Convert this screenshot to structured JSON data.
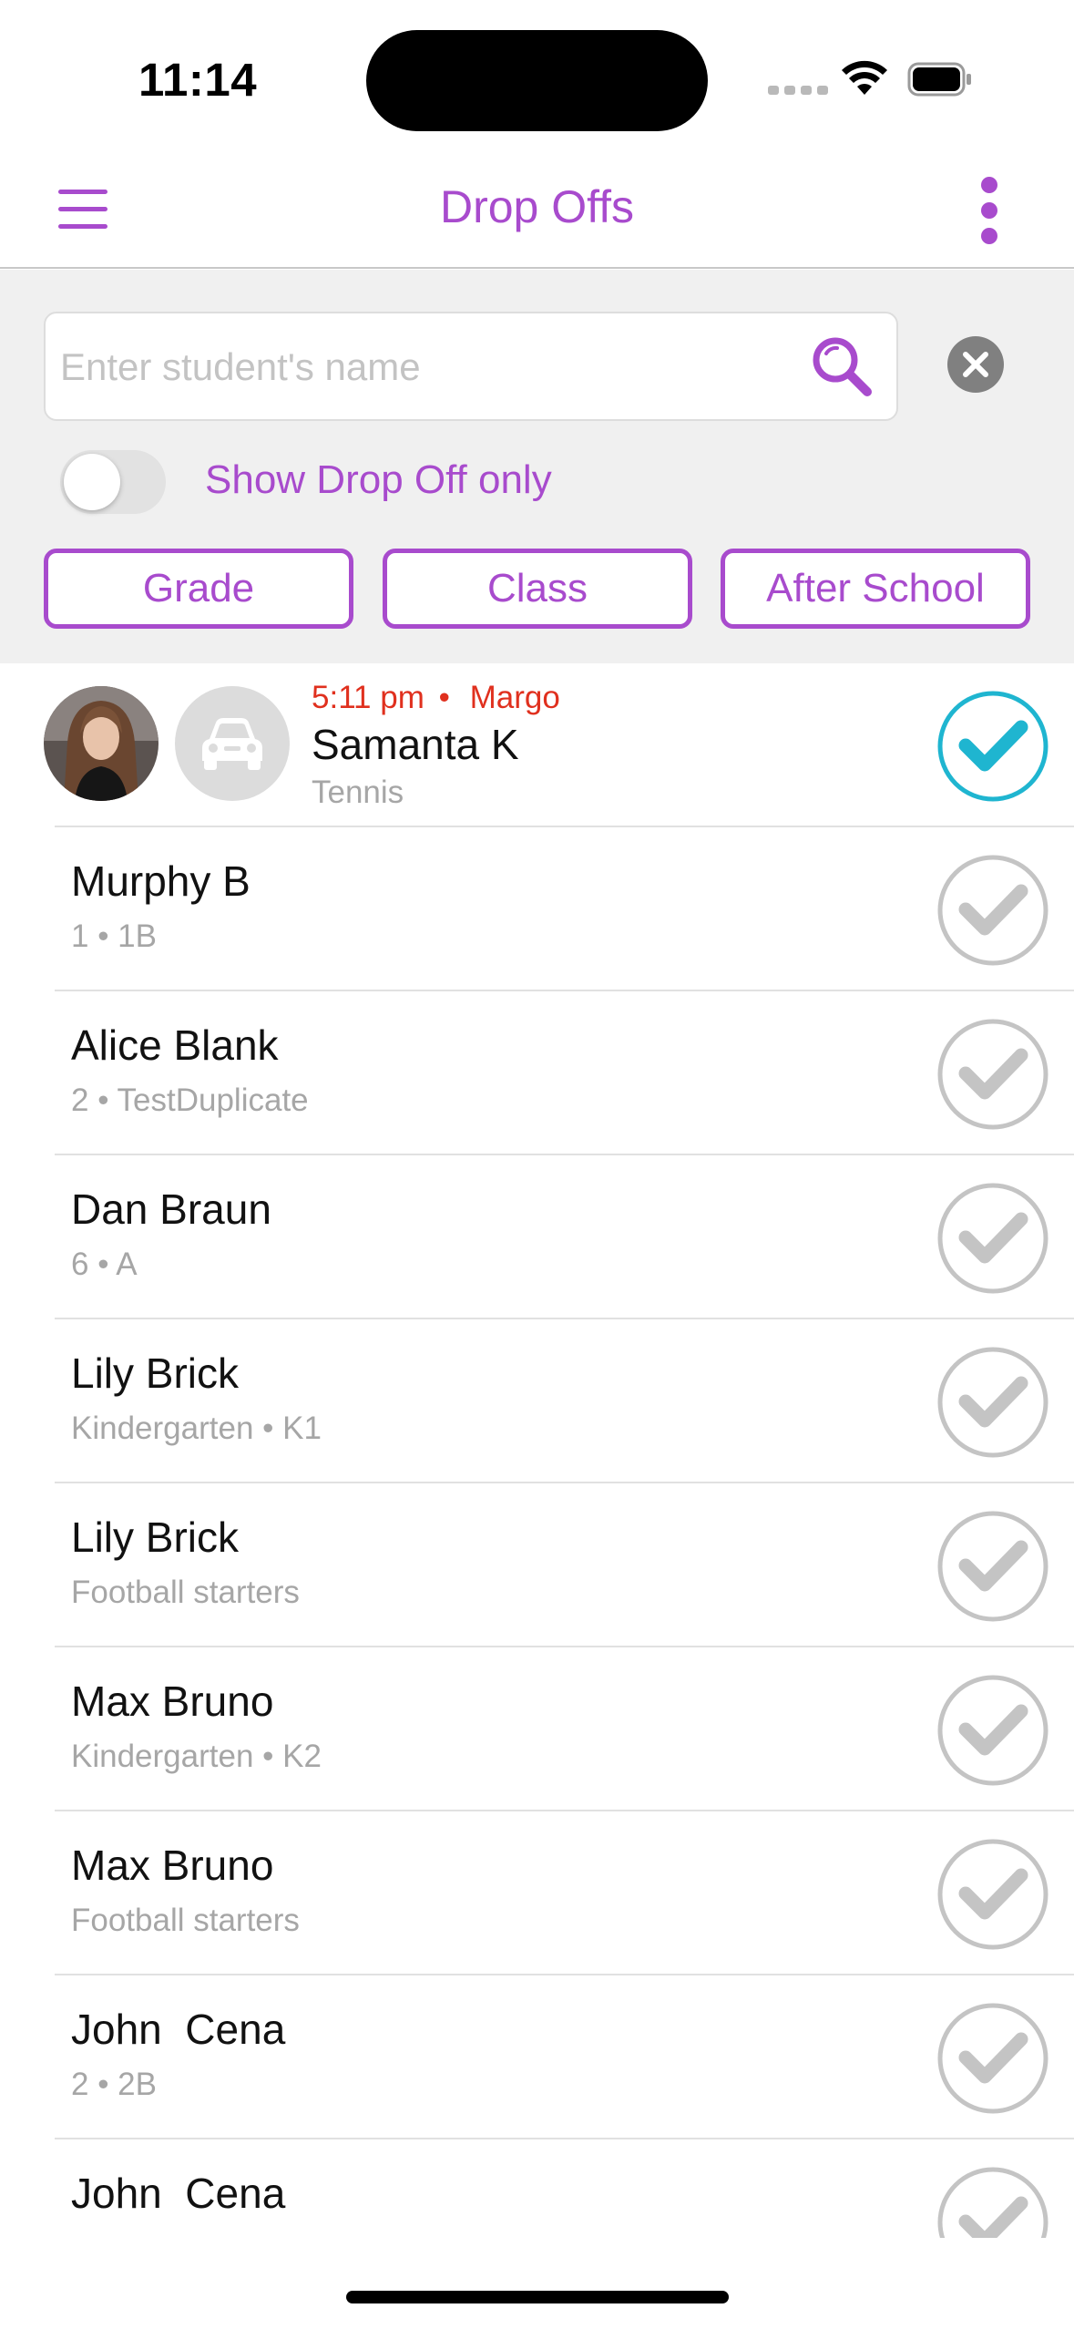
{
  "status_bar": {
    "time": "11:14"
  },
  "nav": {
    "title": "Drop Offs"
  },
  "search": {
    "placeholder": "Enter student's name"
  },
  "toggle": {
    "label": "Show Drop Off only",
    "on": false
  },
  "filters": [
    {
      "label": "Grade"
    },
    {
      "label": "Class"
    },
    {
      "label": "After School"
    }
  ],
  "first_student": {
    "time": "5:11 pm",
    "separator": "•",
    "picked_by": "Margo",
    "name": "Samanta K",
    "sub": "Tennis",
    "dropped_off": true
  },
  "students": [
    {
      "name": "Murphy B",
      "sub": "1 • 1B"
    },
    {
      "name": "Alice Blank",
      "sub": "2 • TestDuplicate"
    },
    {
      "name": "Dan Braun",
      "sub": "6 • A"
    },
    {
      "name": "Lily Brick",
      "sub": "Kindergarten • K1"
    },
    {
      "name": "Lily Brick",
      "sub": "Football starters"
    },
    {
      "name": "Max Bruno",
      "sub": "Kindergarten • K2"
    },
    {
      "name": "Max Bruno",
      "sub": "Football starters"
    },
    {
      "name": "John  Cena",
      "sub": "2 • 2B"
    },
    {
      "name": "John  Cena",
      "sub": ""
    }
  ],
  "colors": {
    "accent": "#a84bcd",
    "checked": "#1fb5d0",
    "unchecked": "#c4c4c4",
    "time_red": "#e0301e"
  },
  "icons": [
    "menu-icon",
    "more-icon",
    "search-icon",
    "clear-icon",
    "car-icon",
    "check-icon",
    "wifi-icon",
    "battery-icon"
  ]
}
